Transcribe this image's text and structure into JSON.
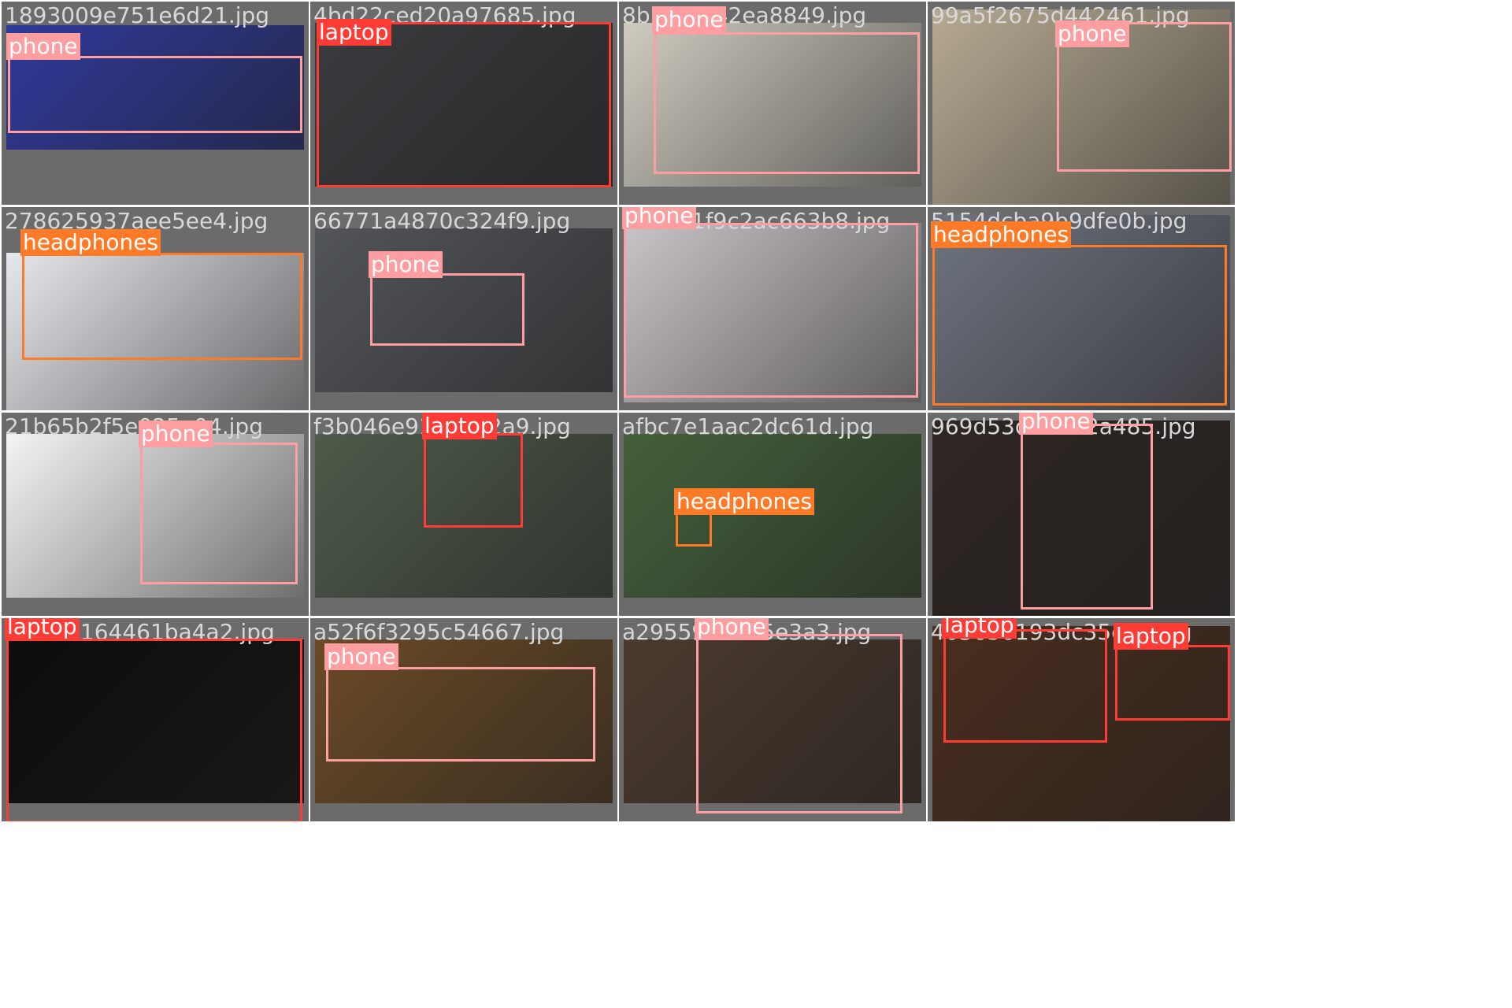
{
  "tiles": [
    {
      "filename": "1893009e751e6d21.jpg",
      "photo": "#2f3a9a",
      "objects": [
        {
          "cls": "phone",
          "label": "phone"
        }
      ]
    },
    {
      "filename": "4bd22ced20a97685.jpg",
      "photo": "#3a3b3e",
      "objects": [
        {
          "cls": "laptop",
          "label": "laptop"
        }
      ]
    },
    {
      "filename": "8b7f90842ea8849.jpg",
      "photo": "#cfcbc0",
      "objects": [
        {
          "cls": "phone",
          "label": "phone"
        }
      ]
    },
    {
      "filename": "99a5f2675d442461.jpg",
      "photo": "#b6aa92",
      "objects": [
        {
          "cls": "phone",
          "label": "phone"
        }
      ]
    },
    {
      "filename": "278625937aee5ee4.jpg",
      "photo": "#e6e7ec",
      "objects": [
        {
          "cls": "headphones",
          "label": "headphones"
        }
      ]
    },
    {
      "filename": "66771a4870c324f9.jpg",
      "photo": "#525559",
      "objects": [
        {
          "cls": "phone",
          "label": "phone"
        }
      ]
    },
    {
      "filename": "3e5a71f9c2ac663b8.jpg",
      "photo": "#c9c4c8",
      "objects": [
        {
          "cls": "phone",
          "label": "phone"
        }
      ]
    },
    {
      "filename": "5154dcba9b9dfe0b.jpg",
      "photo": "#6e7480",
      "objects": [
        {
          "cls": "headphones",
          "label": "headphones"
        }
      ]
    },
    {
      "filename": "21b65b2f5e025a04.jpg",
      "photo": "#f4f4f4",
      "objects": [
        {
          "cls": "phone",
          "label": "phone"
        }
      ]
    },
    {
      "filename": "f3b046e914a8e2a9.jpg",
      "photo": "#4e5a4a",
      "objects": [
        {
          "cls": "laptop",
          "label": "laptop"
        }
      ]
    },
    {
      "filename": "afbc7e1aac2dc61d.jpg",
      "photo": "#44603a",
      "objects": [
        {
          "cls": "headphones",
          "label": "headphones"
        }
      ]
    },
    {
      "filename": "969d53d50722a485.jpg",
      "photo": "#2e2622",
      "objects": [
        {
          "cls": "phone",
          "label": "phone"
        }
      ]
    },
    {
      "filename": "6f2e9c164461ba4a2.jpg",
      "photo": "#0d0d0d",
      "objects": [
        {
          "cls": "laptop",
          "label": "laptop"
        }
      ]
    },
    {
      "filename": "a52f6f3295c54667.jpg",
      "photo": "#6a4a26",
      "objects": [
        {
          "cls": "phone",
          "label": "phone"
        }
      ]
    },
    {
      "filename": "a29559e09a5e3a3.jpg",
      "photo": "#4a3a2e",
      "objects": [
        {
          "cls": "phone",
          "label": "phone"
        }
      ]
    },
    {
      "filename": "403656193dc35cad.jpg",
      "photo": "#4a2e1e",
      "objects": [
        {
          "cls": "laptop",
          "label": "laptop"
        },
        {
          "cls": "laptop",
          "label": "laptop"
        }
      ]
    }
  ]
}
